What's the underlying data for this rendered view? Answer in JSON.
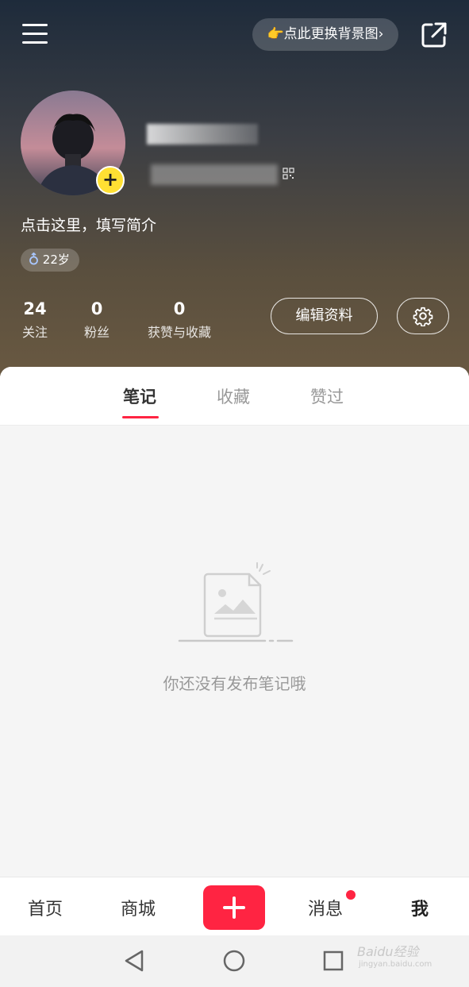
{
  "header": {
    "bg_change_label": "👉点此更换背景图",
    "bio": "点击这里，填写简介",
    "age": "22岁"
  },
  "stats": [
    {
      "count": "24",
      "label": "关注"
    },
    {
      "count": "0",
      "label": "粉丝"
    },
    {
      "count": "0",
      "label": "获赞与收藏"
    }
  ],
  "buttons": {
    "edit_profile": "编辑资料"
  },
  "tabs": [
    {
      "label": "笔记",
      "active": true
    },
    {
      "label": "收藏",
      "active": false
    },
    {
      "label": "赞过",
      "active": false
    }
  ],
  "empty_state": {
    "text": "你还没有发布笔记哦"
  },
  "bottom_nav": {
    "home": "首页",
    "mall": "商城",
    "messages": "消息",
    "me": "我"
  },
  "watermark": {
    "brand": "Baidu经验",
    "url": "jingyan.baidu.com"
  },
  "colors": {
    "accent": "#ff2442",
    "avatar_badge": "#ffe033"
  }
}
